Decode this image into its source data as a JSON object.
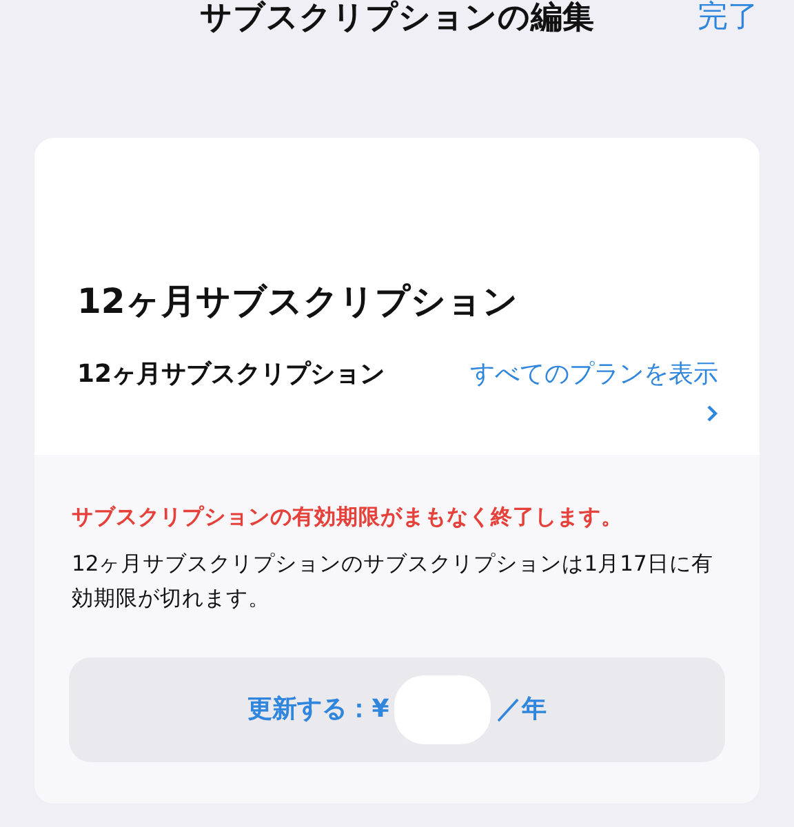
{
  "nav": {
    "title": "サブスクリプションの編集",
    "done": "完了"
  },
  "card": {
    "heading": "12ヶ月サブスクリプション",
    "plan_name": "12ヶ月サブスクリプション",
    "all_plans_link": "すべてのプランを表示",
    "warning": "サブスクリプションの有効期限がまもなく終了します。",
    "message": "12ヶ月サブスクリプションのサブスクリプションは1月17日に有効期限が切れます。",
    "renew_button": {
      "label_start": "更新する：¥",
      "label_end": "／年"
    }
  }
}
